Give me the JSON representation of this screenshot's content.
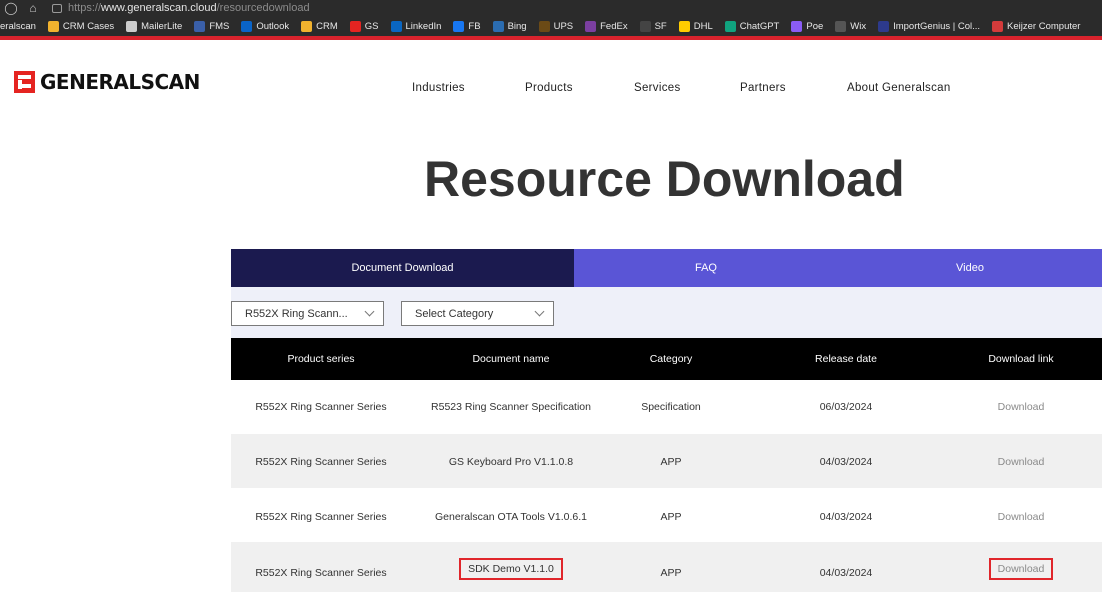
{
  "browser": {
    "url_prefix": "https://",
    "url_domain": "www.generalscan.cloud",
    "url_path": "/resourcedownload",
    "bookmarks": [
      {
        "label": "eralscan",
        "icon": "none",
        "color": ""
      },
      {
        "label": "CRM Cases",
        "icon": "windows-icon",
        "color": "#f1b22e"
      },
      {
        "label": "MailerLite",
        "icon": "page-icon",
        "color": "#cccccc"
      },
      {
        "label": "FMS",
        "icon": "globe-icon",
        "color": "#3a5fa8"
      },
      {
        "label": "Outlook",
        "icon": "outlook-icon",
        "color": "#0a64c8"
      },
      {
        "label": "CRM",
        "icon": "windows-icon",
        "color": "#f1b22e"
      },
      {
        "label": "GS",
        "icon": "gs-icon",
        "color": "#e52421"
      },
      {
        "label": "LinkedIn",
        "icon": "linkedin-icon",
        "color": "#0a66c2"
      },
      {
        "label": "FB",
        "icon": "facebook-icon",
        "color": "#1877f2"
      },
      {
        "label": "Bing",
        "icon": "bing-icon",
        "color": "#2b6cb0"
      },
      {
        "label": "UPS",
        "icon": "ups-icon",
        "color": "#6b4a16"
      },
      {
        "label": "FedEx",
        "icon": "fedex-icon",
        "color": "#7b3fa0"
      },
      {
        "label": "SF",
        "icon": "sf-icon",
        "color": "#444444"
      },
      {
        "label": "DHL",
        "icon": "dhl-icon",
        "color": "#ffcc00"
      },
      {
        "label": "ChatGPT",
        "icon": "chatgpt-icon",
        "color": "#10a37f"
      },
      {
        "label": "Poe",
        "icon": "poe-icon",
        "color": "#8a5cf5"
      },
      {
        "label": "Wix",
        "icon": "wix-icon",
        "color": "#555555"
      },
      {
        "label": "ImportGenius | Col...",
        "icon": "ig-icon",
        "color": "#2d3a8c"
      },
      {
        "label": "Keijzer Computer",
        "icon": "k-icon",
        "color": "#d43b3b"
      }
    ]
  },
  "site": {
    "logo_text": "GENERALSCAN",
    "nav": [
      "Industries",
      "Products",
      "Services",
      "Partners",
      "About Generalscan"
    ],
    "page_title": "Resource Download"
  },
  "tabs": [
    {
      "label": "Document Download",
      "active": true
    },
    {
      "label": "FAQ",
      "active": false
    },
    {
      "label": "Video",
      "active": false
    }
  ],
  "filters": {
    "product_series": "R552X Ring Scann...",
    "category": "Select Category"
  },
  "table": {
    "headers": [
      "Product series",
      "Document name",
      "Category",
      "Release date",
      "Download link"
    ],
    "rows": [
      {
        "series": "R552X Ring Scanner Series",
        "name": "R5523 Ring Scanner Specification",
        "category": "Specification",
        "date": "06/03/2024",
        "link": "Download"
      },
      {
        "series": "R552X Ring Scanner Series",
        "name": "GS Keyboard Pro V1.1.0.8",
        "category": "APP",
        "date": "04/03/2024",
        "link": "Download"
      },
      {
        "series": "R552X Ring Scanner Series",
        "name": "Generalscan OTA Tools V1.0.6.1",
        "category": "APP",
        "date": "04/03/2024",
        "link": "Download"
      },
      {
        "series": "R552X Ring Scanner Series",
        "name": "SDK Demo V1.1.0",
        "category": "APP",
        "date": "04/03/2024",
        "link": "Download"
      }
    ]
  },
  "colors": {
    "tab_active": "#1b1a4f",
    "tab_inactive": "#5a55d6",
    "highlight": "#e0262b",
    "brand_red": "#e52421"
  }
}
